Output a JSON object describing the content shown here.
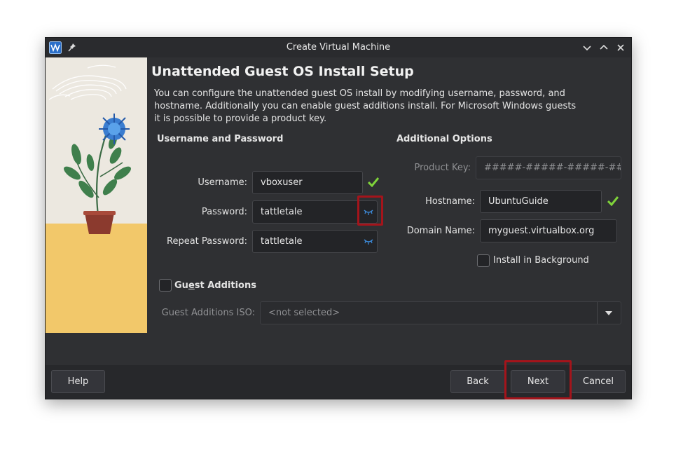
{
  "window": {
    "title": "Create Virtual Machine"
  },
  "page": {
    "heading": "Unattended Guest OS Install Setup",
    "description": "You can configure the unattended guest OS install by modifying username, password, and hostname. Additionally you can enable guest additions install. For Microsoft Windows guests it is possible to provide a product key."
  },
  "user_section": {
    "title": "Username and Password",
    "username_label": "Username:",
    "username_value": "vboxuser",
    "password_label": "Password:",
    "password_value": "tattletale",
    "repeat_label": "Repeat Password:",
    "repeat_value": "tattletale"
  },
  "options_section": {
    "title": "Additional Options",
    "product_key_label": "Product Key:",
    "product_key_placeholder": "#####-#####-#####-#####-#####",
    "hostname_label": "Hostname:",
    "hostname_value": "UbuntuGuide",
    "domain_label": "Domain Name:",
    "domain_value": "myguest.virtualbox.org",
    "install_bg_label": "Install in Background",
    "install_bg_checked": false
  },
  "guest_additions": {
    "label_pre": "Gu",
    "label_mnemonic": "e",
    "label_post": "st Additions",
    "checked": false,
    "iso_label": "Guest Additions ISO:",
    "iso_value": "<not selected>"
  },
  "buttons": {
    "help": "Help",
    "back": "Back",
    "next": "Next",
    "cancel": "Cancel"
  },
  "colors": {
    "highlight": "#a4141b",
    "valid_check": "#7fd33a",
    "eye_icon": "#3d8ee0",
    "window_bg": "#2f3033"
  }
}
